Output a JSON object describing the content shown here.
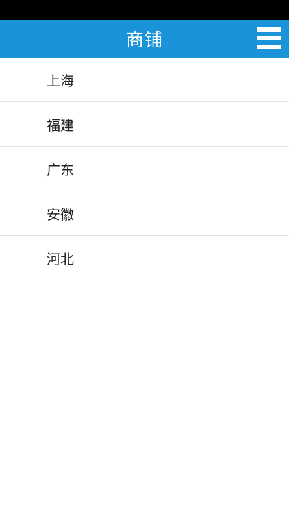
{
  "header": {
    "title": "商铺",
    "menu_icon": "hamburger-menu-icon"
  },
  "colors": {
    "header_bg": "#1b93d8",
    "status_bar_bg": "#000000",
    "divider": "#e3e3e3"
  },
  "regions": [
    {
      "label": "上海"
    },
    {
      "label": "福建"
    },
    {
      "label": "广东"
    },
    {
      "label": "安徽"
    },
    {
      "label": "河北"
    }
  ]
}
